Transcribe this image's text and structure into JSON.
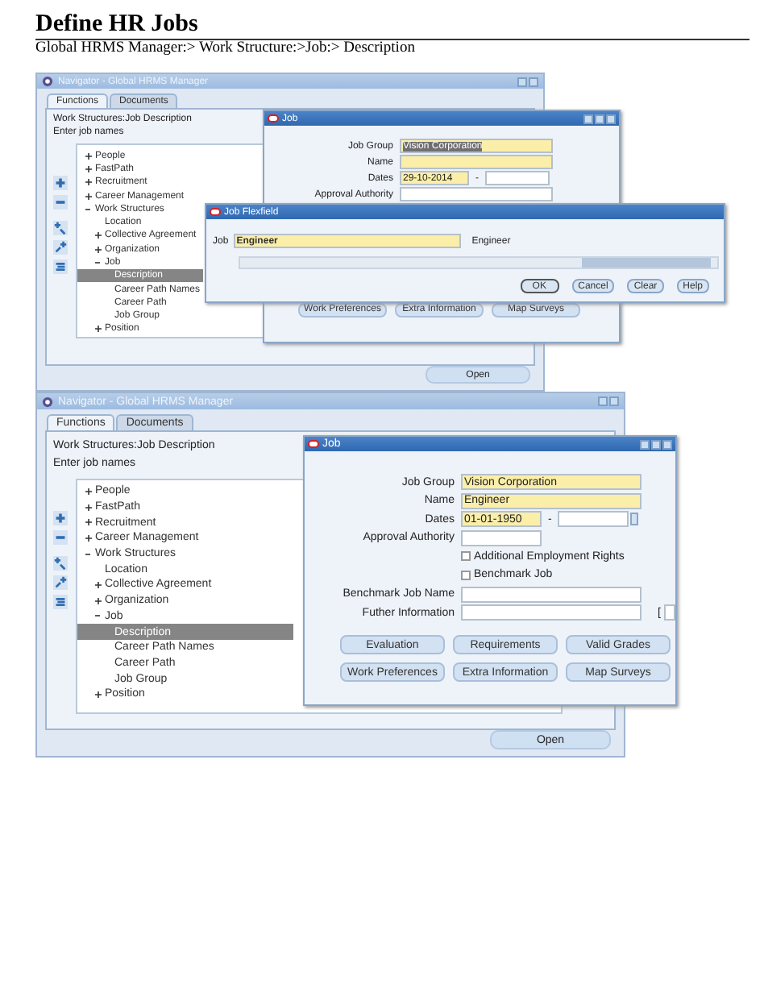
{
  "title": "Define HR Jobs",
  "path": "Global HRMS Manager:> Work Structure:>Job:> Description",
  "screens": [
    {
      "navigator": {
        "title": "Navigator - Global HRMS Manager",
        "tabs": [
          {
            "label": "Functions",
            "selected": true
          },
          {
            "label": "Documents",
            "selected": false
          }
        ],
        "heading": "Work Structures:Job Description",
        "prompt": "Enter job names",
        "tree": [
          {
            "label": "People",
            "expanded": false,
            "selected": false
          },
          {
            "label": "FastPath",
            "expanded": false,
            "selected": false
          },
          {
            "label": "Recruitment",
            "expanded": false,
            "selected": false
          },
          {
            "label": "Career Management",
            "expanded": false,
            "selected": false
          },
          {
            "label": "Work Structures",
            "expanded": true,
            "selected": false,
            "children": [
              {
                "label": "Location",
                "selected": false
              },
              {
                "label": "Collective Agreement",
                "expanded": false,
                "selected": false
              },
              {
                "label": "Organization",
                "expanded": false,
                "selected": false
              },
              {
                "label": "Job",
                "expanded": true,
                "selected": false,
                "children": [
                  {
                    "label": "Description",
                    "selected": true
                  },
                  {
                    "label": "Career Path Names",
                    "selected": false
                  },
                  {
                    "label": "Career Path",
                    "selected": false
                  },
                  {
                    "label": "Job Group",
                    "selected": false
                  }
                ]
              },
              {
                "label": "Position",
                "expanded": false,
                "selected": false
              }
            ]
          }
        ],
        "open_button": "Open"
      },
      "job_window": {
        "title": "Job",
        "fields": [
          {
            "kind": "text",
            "label": "Job Group",
            "value": "Vision Corporation",
            "required": true,
            "selected": true
          },
          {
            "kind": "text",
            "label": "Name",
            "required": true
          },
          {
            "kind": "dates",
            "label": "Dates",
            "value": "29-10-2014",
            "separator": "-",
            "required": true,
            "selected": false
          },
          {
            "kind": "text",
            "label": "Approval Authority",
            "required": false
          }
        ],
        "buttons": [
          [
            "Work Preferences",
            "Extra Information",
            "Map Surveys"
          ]
        ]
      },
      "flexfield": {
        "title": "Job Flexfield",
        "label": "Job",
        "value": "Engineer",
        "description": "Engineer",
        "buttons": [
          "OK",
          "Cancel",
          "Clear",
          "Help"
        ]
      }
    },
    {
      "navigator": {
        "title": "Navigator - Global HRMS Manager",
        "tabs": [
          {
            "label": "Functions",
            "selected": true
          },
          {
            "label": "Documents",
            "selected": false
          }
        ],
        "heading": "Work Structures:Job Description",
        "prompt": "Enter job names",
        "tree": [
          {
            "label": "People",
            "expanded": false,
            "selected": false
          },
          {
            "label": "FastPath",
            "expanded": false,
            "selected": false
          },
          {
            "label": "Recruitment",
            "expanded": false,
            "selected": false
          },
          {
            "label": "Career Management",
            "expanded": false,
            "selected": false
          },
          {
            "label": "Work Structures",
            "expanded": true,
            "selected": false,
            "children": [
              {
                "label": "Location",
                "selected": false
              },
              {
                "label": "Collective Agreement",
                "expanded": false,
                "selected": false
              },
              {
                "label": "Organization",
                "expanded": false,
                "selected": false
              },
              {
                "label": "Job",
                "expanded": true,
                "selected": false,
                "children": [
                  {
                    "label": "Description",
                    "selected": true
                  },
                  {
                    "label": "Career Path Names",
                    "selected": false
                  },
                  {
                    "label": "Career Path",
                    "selected": false
                  },
                  {
                    "label": "Job Group",
                    "selected": false
                  }
                ]
              },
              {
                "label": "Position",
                "expanded": false,
                "selected": false
              }
            ]
          }
        ],
        "open_button": "Open"
      },
      "job_window": {
        "title": "Job",
        "fields": [
          {
            "kind": "text",
            "label": "Job Group",
            "value": "Vision Corporation",
            "required": true,
            "selected": false
          },
          {
            "kind": "text",
            "label": "Name",
            "value": "Engineer",
            "required": true,
            "selected": false
          },
          {
            "kind": "dates",
            "label": "Dates",
            "value": "01-01-1950",
            "separator": "-",
            "required": true,
            "selected": false
          },
          {
            "kind": "short",
            "label": "Approval Authority",
            "required": false
          },
          {
            "kind": "check",
            "label": "Additional Employment Rights",
            "checked": false
          },
          {
            "kind": "check",
            "label": "Benchmark Job",
            "checked": false
          },
          {
            "kind": "text",
            "label": "Benchmark Job Name",
            "required": false
          },
          {
            "kind": "text",
            "label": "Futher Information",
            "required": false,
            "bracket": "["
          }
        ],
        "buttons": [
          [
            "Evaluation",
            "Requirements",
            "Valid Grades"
          ],
          [
            "Work Preferences",
            "Extra Information",
            "Map Surveys"
          ]
        ]
      }
    }
  ]
}
